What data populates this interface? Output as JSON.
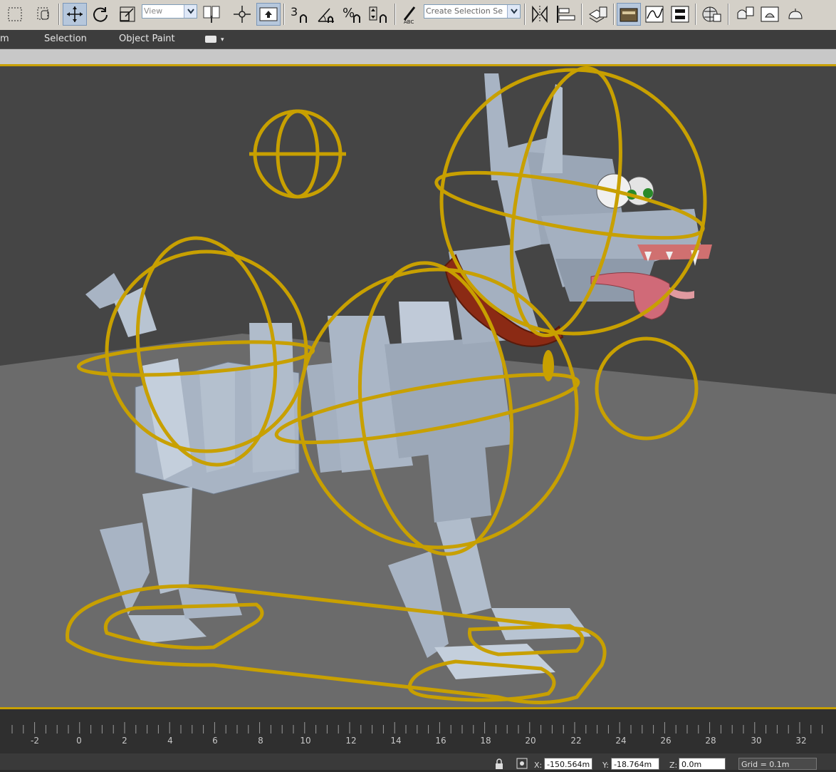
{
  "toolbar": {
    "reference_coord": "View",
    "selection_set_placeholder": "Create Selection Se",
    "snap_angle_label": "3",
    "percent_snap_label": "%",
    "colors": {
      "bg": "#d4d0c8",
      "active": "#b6c7dc"
    }
  },
  "ribbon": {
    "tabs": [
      "m",
      "Selection",
      "Object Paint"
    ]
  },
  "timeline": {
    "labels": [
      "-2",
      "0",
      "2",
      "4",
      "6",
      "8",
      "10",
      "12",
      "14",
      "16",
      "18",
      "20",
      "22",
      "24",
      "26",
      "28",
      "30",
      "32"
    ]
  },
  "status": {
    "x_label": "X:",
    "x_value": "-150.564m",
    "y_label": "Y:",
    "y_value": "-18.764m",
    "z_label": "Z:",
    "z_value": "0.0m",
    "grid": "Grid = 0.1m"
  },
  "viewport": {
    "colors": {
      "rig": "#c8a000",
      "body": "#a8b4c4",
      "collar": "#8b2a14",
      "tongue": "#d06a78",
      "background": "#454545",
      "floor": "#6b6b6b"
    }
  }
}
